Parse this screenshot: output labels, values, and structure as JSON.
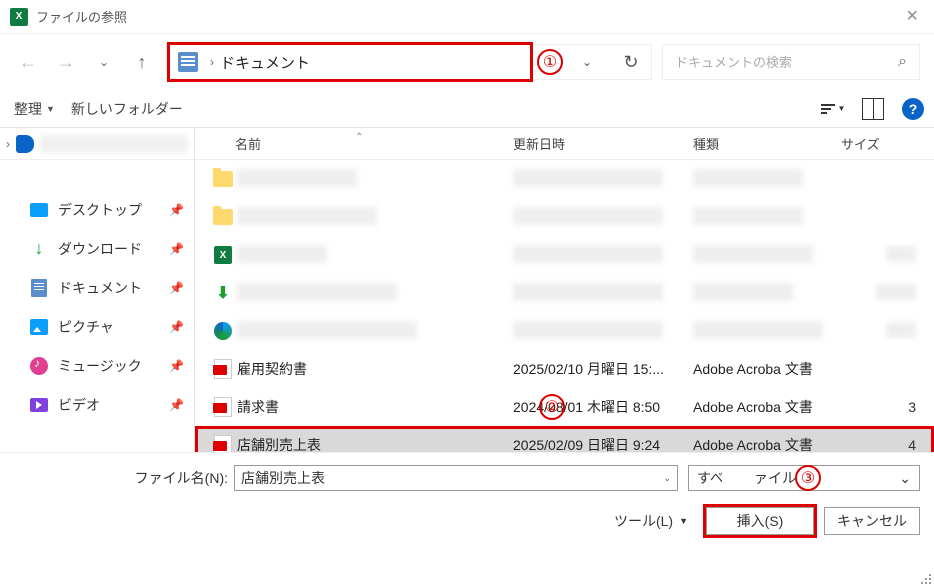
{
  "window": {
    "title": "ファイルの参照"
  },
  "address": {
    "location": "ドキュメント"
  },
  "search": {
    "placeholder": "ドキュメントの検索"
  },
  "toolbar": {
    "organize": "整理",
    "newfolder": "新しいフォルダー"
  },
  "markers": {
    "m1": "①",
    "m2": "②",
    "m3": "③"
  },
  "tree": {
    "items": [
      {
        "label": "デスクトップ"
      },
      {
        "label": "ダウンロード"
      },
      {
        "label": "ドキュメント"
      },
      {
        "label": "ピクチャ"
      },
      {
        "label": "ミュージック"
      },
      {
        "label": "ビデオ"
      }
    ]
  },
  "columns": {
    "name": "名前",
    "date": "更新日時",
    "type": "種類",
    "size": "サイズ"
  },
  "rows": [
    {
      "name": "雇用契約書",
      "date": "2025/02/10 月曜日 15:...",
      "type": "Adobe Acroba 文書",
      "size": ""
    },
    {
      "name": "請求書",
      "date": "2024/08/01 木曜日 8:50",
      "type": "Adobe Acroba 文書",
      "size": "3"
    },
    {
      "name": "店舗別売上表",
      "date": "2025/02/09 日曜日 9:24",
      "type": "Adobe Acroba 文書",
      "size": "4"
    }
  ],
  "footer": {
    "filename_label": "ファイル名(N):",
    "filename_value": "店舗別売上表",
    "filter_pre": "すべ",
    "filter_post": "ァイル",
    "tools": "ツール(L)",
    "insert": "挿入(S)",
    "cancel": "キャンセル"
  }
}
